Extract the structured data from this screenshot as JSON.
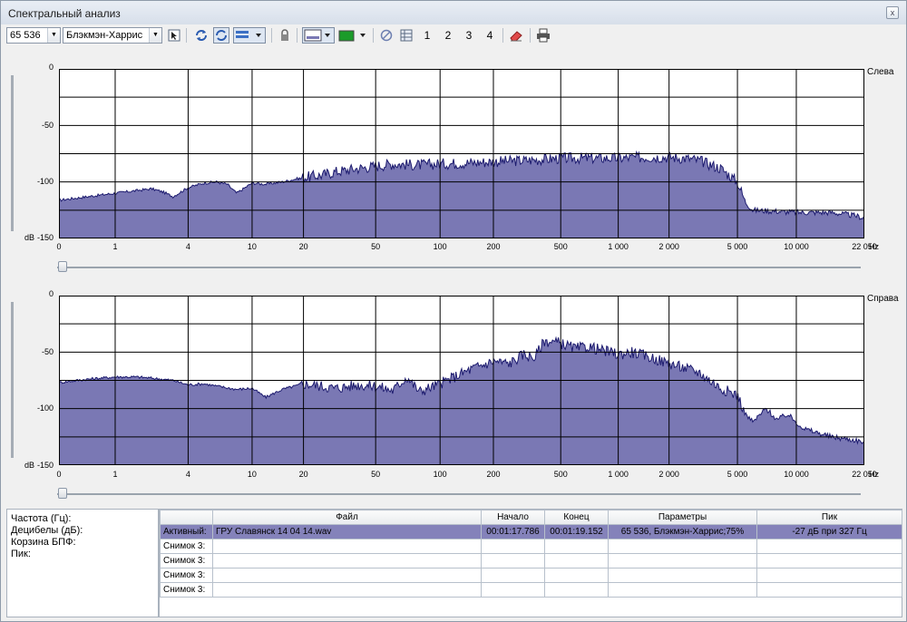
{
  "window": {
    "title": "Спектральный анализ",
    "close_label": "x"
  },
  "toolbar": {
    "fft_size": "65 536",
    "window_function": "Блэкмэн-Харрис",
    "snapshot_1": "1",
    "snapshot_2": "2",
    "snapshot_3": "3",
    "snapshot_4": "4",
    "icons": [
      "cursor-icon",
      "refresh-icon",
      "sync-icon",
      "overlay-icon",
      "lock-icon",
      "display-mode-icon",
      "color-icon",
      "clear-icon",
      "table-icon",
      "erase-icon",
      "print-icon"
    ]
  },
  "channels": [
    {
      "label": "Слева",
      "dB_label": "dB"
    },
    {
      "label": "Справа",
      "dB_label": "dB"
    }
  ],
  "axes": {
    "y_ticks": [
      "0",
      "-50",
      "-100",
      "-150"
    ],
    "x_ticks": [
      "0",
      "1",
      "4",
      "10",
      "20",
      "50",
      "100",
      "200",
      "500",
      "1 000",
      "2 000",
      "5 000",
      "10 000",
      "22 050"
    ],
    "x_unit": "Hz"
  },
  "colors": {
    "fill": "#7a78b4",
    "line": "#1c1a6e",
    "grid": "#000000",
    "active_row": "#8482ba"
  },
  "chart_data": [
    {
      "type": "area",
      "title": "Слева",
      "ylabel": "dB",
      "xlabel": "Hz",
      "x_scale": "log",
      "ylim": [
        -150,
        0
      ],
      "x": [
        1,
        2,
        2.5,
        3,
        4,
        5,
        6,
        7,
        8,
        10,
        12,
        15,
        20,
        25,
        30,
        40,
        50,
        60,
        80,
        100,
        150,
        200,
        300,
        400,
        500,
        700,
        1000,
        1500,
        2000,
        2500,
        3000,
        4000,
        5000,
        5500,
        6000,
        8000,
        10000,
        15000,
        20000,
        22050
      ],
      "y": [
        -110,
        -106,
        -109,
        -113,
        -105,
        -101,
        -100,
        -102,
        -110,
        -101,
        -102,
        -100,
        -96,
        -94,
        -91,
        -88,
        -86,
        -84,
        -85,
        -84,
        -83,
        -82,
        -81,
        -80,
        -79,
        -79,
        -79,
        -78,
        -78,
        -79,
        -81,
        -88,
        -100,
        -118,
        -125,
        -126,
        -127,
        -127,
        -130,
        -132
      ]
    },
    {
      "type": "area",
      "title": "Справа",
      "ylabel": "dB",
      "xlabel": "Hz",
      "x_scale": "log",
      "ylim": [
        -150,
        0
      ],
      "x": [
        0,
        0.5,
        1,
        1.5,
        2,
        3,
        4,
        5,
        6,
        8,
        10,
        12,
        15,
        20,
        25,
        30,
        40,
        50,
        60,
        70,
        80,
        100,
        120,
        150,
        200,
        250,
        300,
        350,
        400,
        500,
        600,
        700,
        800,
        1000,
        1200,
        1500,
        2000,
        3000,
        4000,
        5000,
        5500,
        6000,
        7000,
        8000,
        9000,
        10000,
        11000,
        12000,
        15000,
        20000,
        22050
      ],
      "y": [
        -77,
        -74,
        -72,
        -72,
        -73,
        -75,
        -79,
        -78,
        -80,
        -83,
        -82,
        -90,
        -83,
        -78,
        -80,
        -82,
        -79,
        -80,
        -84,
        -72,
        -85,
        -78,
        -72,
        -65,
        -58,
        -60,
        -52,
        -55,
        -40,
        -42,
        -47,
        -45,
        -48,
        -52,
        -50,
        -54,
        -60,
        -68,
        -82,
        -88,
        -105,
        -112,
        -100,
        -110,
        -105,
        -112,
        -118,
        -120,
        -125,
        -128,
        -130
      ]
    }
  ],
  "info_labels": [
    "Частота (Гц):",
    "Децибелы (дБ):",
    "Корзина БПФ:",
    "Пик:"
  ],
  "table": {
    "headers": [
      "",
      "Файл",
      "Начало",
      "Конец",
      "Параметры",
      "Пик"
    ],
    "rows": [
      [
        "Активный:",
        "ГРУ Славянск 14 04 14.wav",
        "00:01:17.786",
        "00:01:19.152",
        "65 536, Блэкмэн-Харрис;75%",
        "-27 дБ при 327 Гц"
      ],
      [
        "Снимок 3:",
        "",
        "",
        "",
        "",
        ""
      ],
      [
        "Снимок 3:",
        "",
        "",
        "",
        "",
        ""
      ],
      [
        "Снимок 3:",
        "",
        "",
        "",
        "",
        ""
      ],
      [
        "Снимок 3:",
        "",
        "",
        "",
        "",
        ""
      ]
    ]
  }
}
